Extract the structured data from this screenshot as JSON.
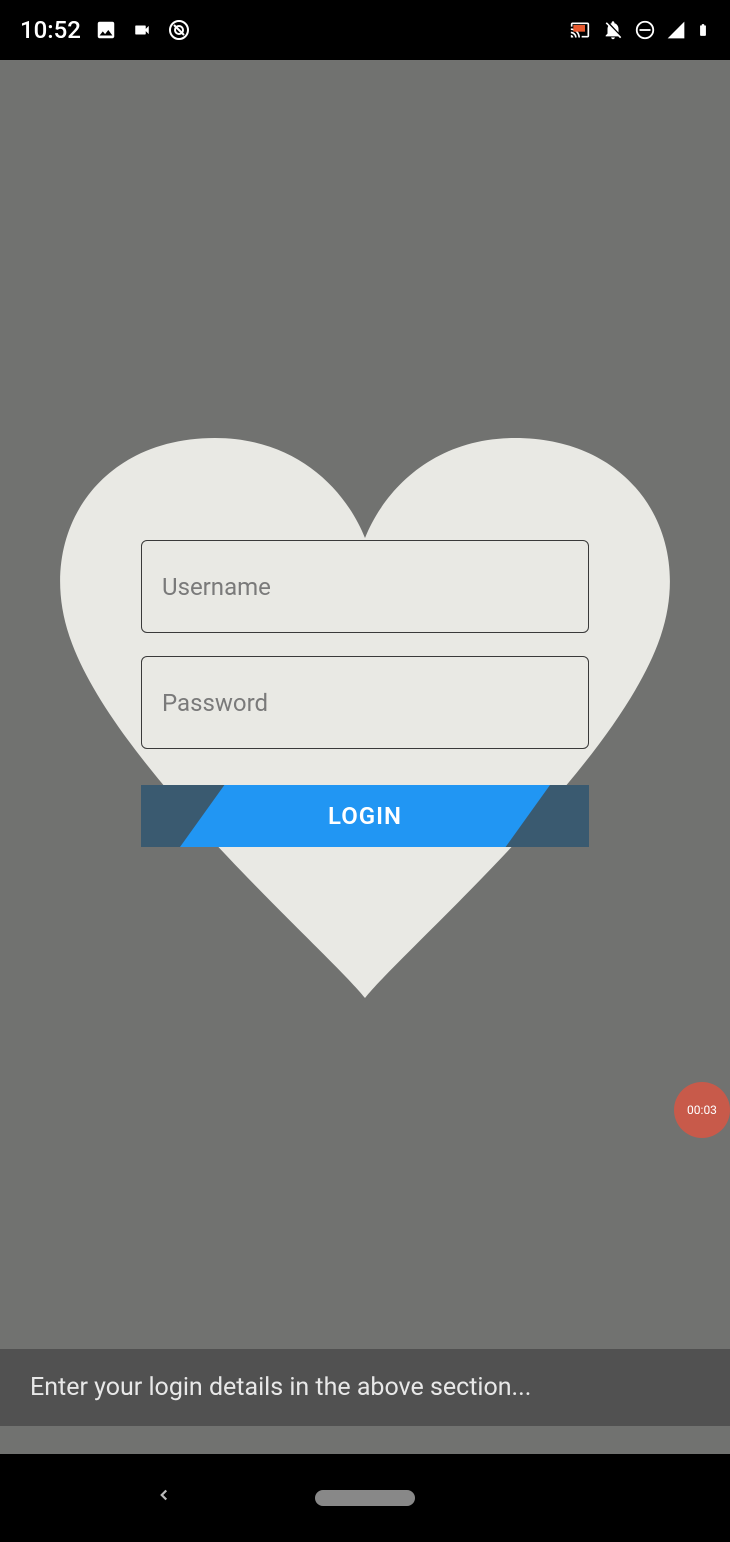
{
  "statusbar": {
    "time": "10:52"
  },
  "form": {
    "username_placeholder": "Username",
    "password_placeholder": "Password",
    "login_label": "LOGIN"
  },
  "record": {
    "time": "00:03"
  },
  "toast": {
    "message": "Enter your login details in the above section..."
  }
}
